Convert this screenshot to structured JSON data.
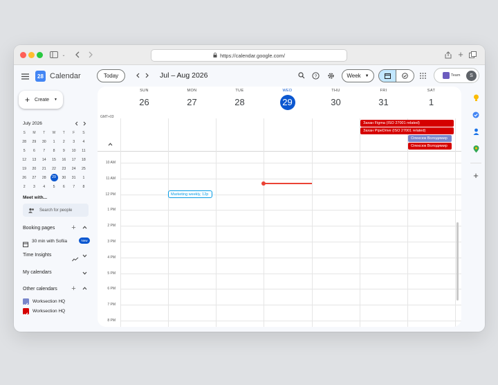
{
  "browser": {
    "url": "https://calendar.google.com/"
  },
  "header": {
    "app_name": "Calendar",
    "logo_number": "28",
    "today_label": "Today",
    "date_range": "Jul – Aug 2026",
    "view_label": "Week",
    "workspace_label": "Team",
    "avatar_letter": "S"
  },
  "sidebar": {
    "create_label": "Create",
    "mini_month": "July 2026",
    "weekday_initials": [
      "S",
      "M",
      "T",
      "W",
      "T",
      "F",
      "S"
    ],
    "weeks": [
      [
        "28",
        "29",
        "30",
        "1",
        "2",
        "3",
        "4"
      ],
      [
        "5",
        "6",
        "7",
        "8",
        "9",
        "10",
        "11"
      ],
      [
        "12",
        "13",
        "14",
        "15",
        "16",
        "17",
        "18"
      ],
      [
        "19",
        "20",
        "21",
        "22",
        "23",
        "24",
        "25"
      ],
      [
        "26",
        "27",
        "28",
        "29",
        "30",
        "31",
        "1"
      ],
      [
        "2",
        "3",
        "4",
        "5",
        "6",
        "7",
        "8"
      ]
    ],
    "meet_title": "Meet with...",
    "search_people_placeholder": "Search for people",
    "booking_title": "Booking pages",
    "booking_item": "30 min with Sofiia",
    "booking_badge": "New",
    "insights_title": "Time Insights",
    "my_calendars_title": "My calendars",
    "other_calendars_title": "Other calendars",
    "other_calendars": [
      {
        "name": "Worksection HQ",
        "color": "#7986cb"
      },
      {
        "name": "Worksection HQ",
        "color": "#d50000"
      }
    ]
  },
  "calendar": {
    "timezone": "GMT+03",
    "days": [
      {
        "name": "SUN",
        "date": "26"
      },
      {
        "name": "MON",
        "date": "27"
      },
      {
        "name": "TUE",
        "date": "28"
      },
      {
        "name": "WED",
        "date": "29",
        "today": true
      },
      {
        "name": "THU",
        "date": "30"
      },
      {
        "name": "FRI",
        "date": "31"
      },
      {
        "name": "SAT",
        "date": "1"
      }
    ],
    "times": [
      "10 AM",
      "11 AM",
      "12 PM",
      "1 PM",
      "2 PM",
      "3 PM",
      "4 PM",
      "5 PM",
      "6 PM",
      "7 PM",
      "8 PM"
    ],
    "allday_events": [
      "Захан Figma (ISO 27001 related)",
      "Захан PipeDrive (ISO 27001 related)",
      "Олексюк Володимир",
      "Олексюк Володимир"
    ],
    "event_marketing": "Marketing weekly, 12p"
  },
  "colors": {
    "accent": "#0b57d0",
    "now_line": "#ea4335",
    "allday_red": "#d50000",
    "allday_lavender": "#7986cb",
    "event_blue": "#039be5"
  }
}
